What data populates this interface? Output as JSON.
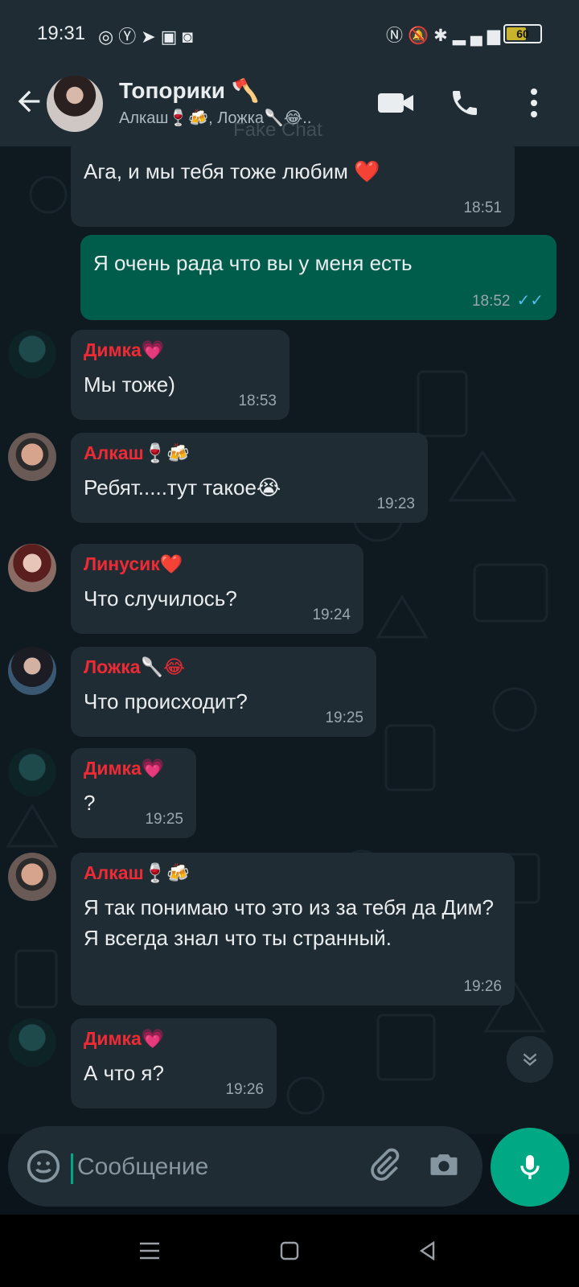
{
  "status_bar": {
    "time": "19:31",
    "left_icons": [
      "whatsapp-icon",
      "yandex-icon",
      "telegram-icon",
      "store-icon",
      "wb-icon"
    ],
    "right_icons": [
      "nfc-icon",
      "mute-icon",
      "bluetooth-icon",
      "signal-4g-icon"
    ],
    "battery": "60",
    "battery_level": 0.6
  },
  "header": {
    "title": "Топорики 🪓",
    "subtitle": "Алкаш🍷🍻, Ложка🥄😂..",
    "watermark": "Fake Chat"
  },
  "messages": [
    {
      "direction": "in",
      "sender": "",
      "text": "Ага, и мы тебя тоже любим ❤️",
      "time": "18:51"
    },
    {
      "direction": "out",
      "text": "Я очень рада что вы у меня есть",
      "time": "18:52",
      "ticks": "✓✓"
    },
    {
      "direction": "in",
      "sender": "Димка💗",
      "text": "Мы тоже)",
      "time": "18:53"
    },
    {
      "direction": "in",
      "sender": "Алкаш🍷🍻",
      "text": "Ребят.....тут такое😭",
      "time": "19:23"
    },
    {
      "direction": "in",
      "sender": "Линусик❤️",
      "text": "Что случилось?",
      "time": "19:24"
    },
    {
      "direction": "in",
      "sender": "Ложка🥄😂",
      "text": "Что происходит?",
      "time": "19:25"
    },
    {
      "direction": "in",
      "sender": "Димка💗",
      "text": "?",
      "time": "19:25"
    },
    {
      "direction": "in",
      "sender": "Алкаш🍷🍻",
      "text": "Я так понимаю что это из за тебя да Дим? Я всегда знал что ты странный.",
      "time": "19:26"
    },
    {
      "direction": "in",
      "sender": "Димка💗",
      "text": "А что я?",
      "time": "19:26"
    }
  ],
  "composer": {
    "placeholder": "Сообщение"
  },
  "colors": {
    "header_bg": "#1f2c34",
    "incoming_bubble": "#202c33",
    "outgoing_bubble": "#005c4b",
    "sender_name": "#ee2a35",
    "accent": "#00a884",
    "read_ticks": "#53bdeb"
  }
}
